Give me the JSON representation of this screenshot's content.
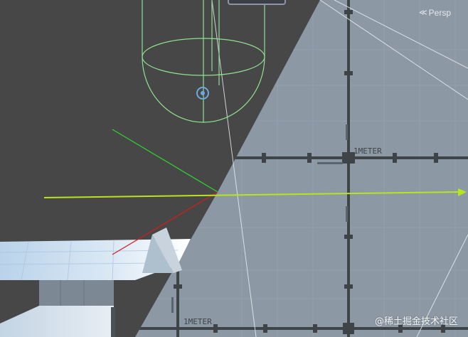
{
  "scene_view": {
    "projection_label": "Persp",
    "projection_icon": "chevron-left-icon",
    "grid_label_primary": "1METER",
    "grid_label_secondary": "1METER",
    "watermark": "@稀土掘金技术社区"
  },
  "colors": {
    "background": "#474747",
    "floor": "#8c99a5",
    "grid_line": "#3f4448",
    "collider": "#8ee08e",
    "axis_green": "#2fd12f",
    "axis_red": "#d21d1d",
    "axis_yellow": "#b5e61d"
  }
}
